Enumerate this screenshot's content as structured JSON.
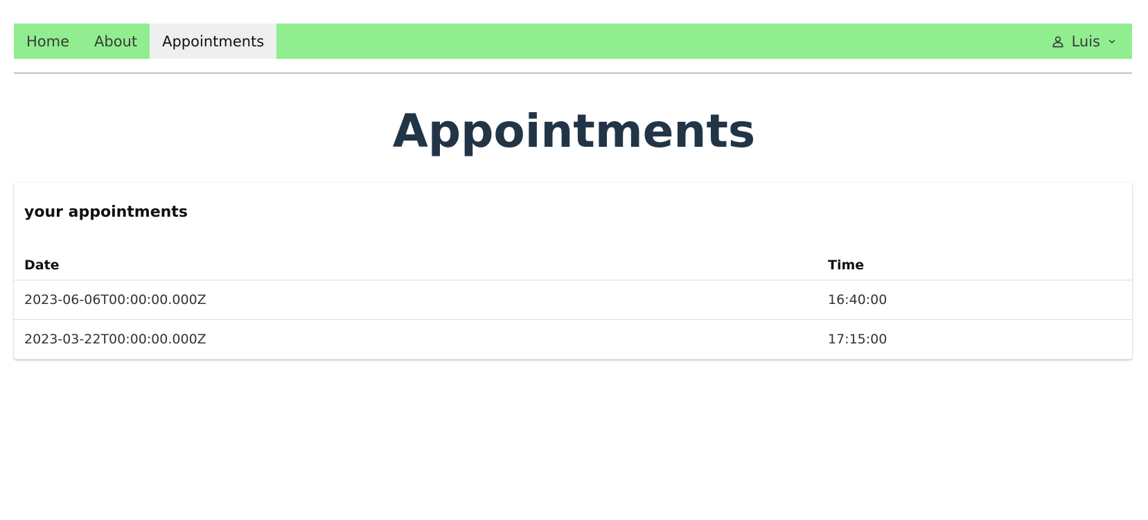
{
  "nav": {
    "items": [
      {
        "label": "Home",
        "active": false
      },
      {
        "label": "About",
        "active": false
      },
      {
        "label": "Appointments",
        "active": true
      }
    ],
    "user": {
      "name": "Luis",
      "icon": "user-icon",
      "menu_icon": "chevron-down-icon"
    },
    "background_color": "#90ee90",
    "active_color": "#efefef"
  },
  "page": {
    "title": "Appointments",
    "title_color": "#213547"
  },
  "card": {
    "title": "your appointments",
    "columns": [
      "Date",
      "Time"
    ],
    "rows": [
      [
        "2023-06-06T00:00:00.000Z",
        "16:40:00"
      ],
      [
        "2023-03-22T00:00:00.000Z",
        "17:15:00"
      ]
    ]
  }
}
